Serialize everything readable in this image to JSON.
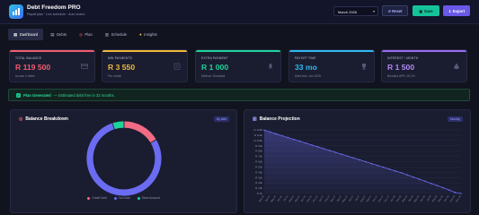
{
  "app": {
    "title": "Debt Freedom PRO",
    "subtitle": "Payoff plan · Live schedule · Auto charts"
  },
  "header": {
    "month": "March 2026",
    "reset_label": "↺ Reset",
    "save_label": "Save",
    "export_label": "Export"
  },
  "tabs": [
    {
      "label": "Dashboard",
      "icon": "dashboard-icon",
      "active": true
    },
    {
      "label": "Debts",
      "icon": "document-icon",
      "active": false
    },
    {
      "label": "Plan",
      "icon": "target-icon",
      "active": false
    },
    {
      "label": "Schedule",
      "icon": "calendar-icon",
      "active": false
    },
    {
      "label": "Insights",
      "icon": "lightbulb-icon",
      "active": false
    }
  ],
  "kpis": [
    {
      "label": "TOTAL BALANCE",
      "value": "R 119 500",
      "sub": "Across 3 debts",
      "accent": "#f25c6e",
      "icon": "credit-card-icon"
    },
    {
      "label": "MIN PAYMENTS",
      "value": "R 3 550",
      "sub": "Per month",
      "accent": "#f2b73c",
      "icon": "receipt-icon"
    },
    {
      "label": "EXTRA PAYMENT",
      "value": "R 1 000",
      "sub": "Method: Snowball",
      "accent": "#1ed39a",
      "icon": "rocket-icon"
    },
    {
      "label": "PAYOFF TIME",
      "value": "33 mo",
      "sub": "Debt free: Jan 2029",
      "accent": "#2fb8f0",
      "icon": "trophy-icon"
    },
    {
      "label": "INTEREST / MONTH",
      "value": "R 1 500",
      "sub": "Blended APR: 15.1%",
      "accent": "#9b6cf2",
      "icon": "money-bag-icon"
    }
  ],
  "banner": {
    "strong": "Plan Generated",
    "text": "— Estimated debt free in 33 months."
  },
  "balance_breakdown": {
    "title": "Balance Breakdown",
    "badge": "By debt",
    "legend": [
      "Credit Card",
      "Car Loan",
      "Store Account"
    ],
    "colors": [
      "#f26b84",
      "#6b6cf2",
      "#1ed39a"
    ],
    "values": [
      16.5,
      78.5,
      5
    ]
  },
  "balance_projection": {
    "title": "Balance Projection",
    "badge": "Monthly",
    "line_color": "#6b6cf2"
  },
  "chart_data": [
    {
      "type": "pie",
      "title": "Balance Breakdown",
      "categories": [
        "Credit Card",
        "Car Loan",
        "Store Account"
      ],
      "values": [
        16.5,
        78.5,
        5
      ]
    },
    {
      "type": "area",
      "title": "Balance Projection",
      "ylim": [
        0,
        120000
      ],
      "y_ticks": [
        "R 0k",
        "R 10k",
        "R 20k",
        "R 30k",
        "R 40k",
        "R 50k",
        "R 60k",
        "R 70k",
        "R 80k",
        "R 90k",
        "R 100k",
        "R 110k",
        "R 120k"
      ],
      "x": [
        "Mar 26",
        "Apr 26",
        "May 26",
        "Jun 26",
        "Jul 26",
        "Aug 26",
        "Sep 26",
        "Oct 26",
        "Nov 26",
        "Dec 26",
        "Jan 27",
        "Feb 27",
        "Mar 27",
        "Apr 27",
        "May 27",
        "Jun 27",
        "Jul 27",
        "Aug 27",
        "Sep 27",
        "Oct 27",
        "Nov 27",
        "Dec 27",
        "Jan 28",
        "Feb 28",
        "Mar 28",
        "Apr 28",
        "May 28",
        "Jun 28",
        "Jul 28",
        "Aug 28",
        "Sep 28",
        "Oct 28",
        "Nov 28",
        "Dec 28"
      ],
      "series": [
        {
          "values": [
            119500,
            116000,
            112500,
            109000,
            105500,
            102000,
            98500,
            95000,
            91500,
            88000,
            84500,
            81000,
            77500,
            74000,
            70500,
            67000,
            63500,
            60000,
            56500,
            53000,
            49500,
            46000,
            42500,
            39000,
            35000,
            31000,
            27000,
            23000,
            19000,
            15000,
            11000,
            6500,
            2000,
            0
          ]
        }
      ]
    }
  ]
}
